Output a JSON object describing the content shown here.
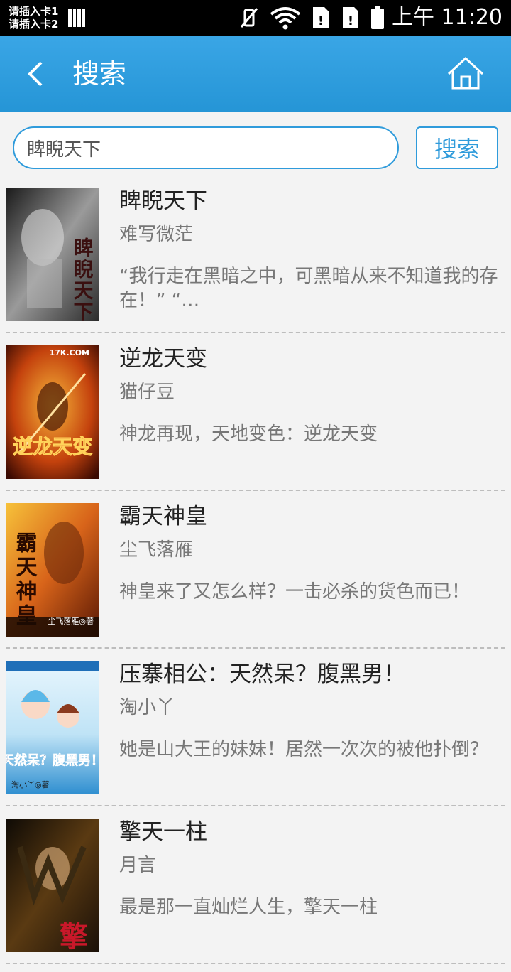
{
  "status": {
    "sim1": "请插入卡1",
    "sim2": "请插入卡2",
    "time": "上午 11:20"
  },
  "header": {
    "title": "搜索"
  },
  "search": {
    "value": "睥睨天下",
    "button_label": "搜索"
  },
  "results": [
    {
      "title": "睥睨天下",
      "author": "难写微茫",
      "desc": "“我行走在黑暗之中，可黑暗从来不知道我的存在！” “…",
      "cover_text": "睥睨天下",
      "cover_colors": [
        "#2b2b2b",
        "#bfbfbf"
      ]
    },
    {
      "title": "逆龙天变",
      "author": "猫仔豆",
      "desc": "神龙再现，天地变色：逆龙天变",
      "cover_text": "逆龙天变",
      "cover_badge": "17K.COM",
      "cover_colors": [
        "#6e1c06",
        "#e07b16"
      ]
    },
    {
      "title": "霸天神皇",
      "author": "尘飞落雁",
      "desc": "神皇来了又怎么样？一击必杀的货色而已！",
      "cover_text": "霸天神皇",
      "cover_badge": "尘飞落雁◎著",
      "cover_colors": [
        "#7a2b06",
        "#f0a21a"
      ]
    },
    {
      "title": "压寨相公：天然呆？腹黑男！",
      "author": "淘小丫",
      "desc": "她是山大王的妹妹！居然一次次的被他扑倒？",
      "cover_text": "天然呆？腹黑男！",
      "cover_badge": "淘小丫◎著",
      "cover_colors": [
        "#cfe9f7",
        "#3aa0dc"
      ]
    },
    {
      "title": "擎天一柱",
      "author": "月言",
      "desc": "最是那一直灿烂人生，擎天一柱",
      "cover_text": "擎",
      "cover_colors": [
        "#1c1208",
        "#6b4a1e"
      ]
    }
  ]
}
